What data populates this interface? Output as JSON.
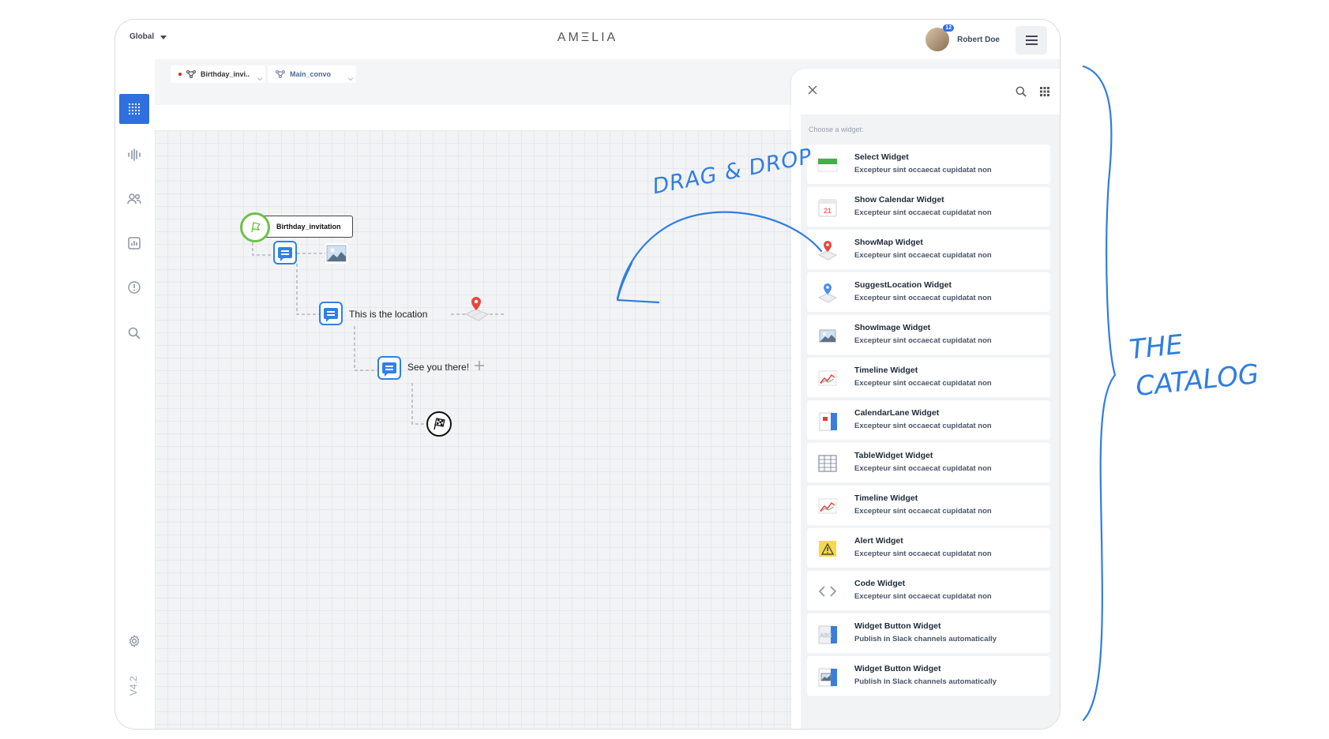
{
  "header": {
    "scope_label": "Global",
    "logo": "AMΞLIA",
    "user_name": "Robert Doe",
    "notification_count": "12"
  },
  "sidebar": {
    "items": [
      "grid-icon",
      "waveform-icon",
      "users-icon",
      "chart-icon",
      "alert-icon",
      "search-icon"
    ],
    "settings": "gear-icon",
    "version": "V4.2"
  },
  "tabs": [
    {
      "label": "Birthday_invi..",
      "unsaved": true
    },
    {
      "label": "Main_convo",
      "unsaved": false
    }
  ],
  "flow": {
    "start_label": "Birthday_invitation",
    "node_location": "This is the location",
    "node_farewell": "See you there!"
  },
  "catalog": {
    "prompt": "Choose a widget:",
    "widgets": [
      {
        "name": "Select Widget",
        "desc": "Excepteur sint occaecat cupidatat non",
        "icon": "select-icon"
      },
      {
        "name": "Show Calendar Widget",
        "desc": "Excepteur sint occaecat cupidatat non",
        "icon": "calendar-icon"
      },
      {
        "name": "ShowMap Widget",
        "desc": "Excepteur sint occaecat cupidatat non",
        "icon": "map-pin-icon"
      },
      {
        "name": "SuggestLocation Widget",
        "desc": "Excepteur sint occaecat cupidatat non",
        "icon": "location-icon"
      },
      {
        "name": "ShowImage Widget",
        "desc": "Excepteur sint occaecat cupidatat non",
        "icon": "image-icon"
      },
      {
        "name": "Timeline  Widget",
        "desc": "Excepteur sint occaecat cupidatat non",
        "icon": "timeline-icon"
      },
      {
        "name": "CalendarLane Widget",
        "desc": "Excepteur sint occaecat cupidatat non",
        "icon": "calendar-lane-icon"
      },
      {
        "name": "TableWidget Widget",
        "desc": "Excepteur sint occaecat cupidatat non",
        "icon": "table-icon"
      },
      {
        "name": "Timeline Widget",
        "desc": "Excepteur sint occaecat cupidatat non",
        "icon": "timeline-icon"
      },
      {
        "name": "Alert Widget",
        "desc": "Excepteur sint occaecat cupidatat non",
        "icon": "alert-icon"
      },
      {
        "name": "Code Widget",
        "desc": "Excepteur sint occaecat cupidatat non",
        "icon": "code-icon"
      },
      {
        "name": "Widget Button Widget",
        "desc": "Publish in Slack channels automatically",
        "icon": "button-abc-icon"
      },
      {
        "name": "Widget Button Widget",
        "desc": "Publish in Slack channels automatically",
        "icon": "button-image-icon"
      }
    ]
  },
  "annotations": {
    "drag_drop": "DRAG & DROP",
    "catalog_line1": "THE",
    "catalog_line2": "CATALOG"
  },
  "colors": {
    "accent": "#2f6fe0",
    "node_blue": "#2f80e8",
    "start_green": "#6cc24a",
    "annotation": "#2f7de1"
  }
}
